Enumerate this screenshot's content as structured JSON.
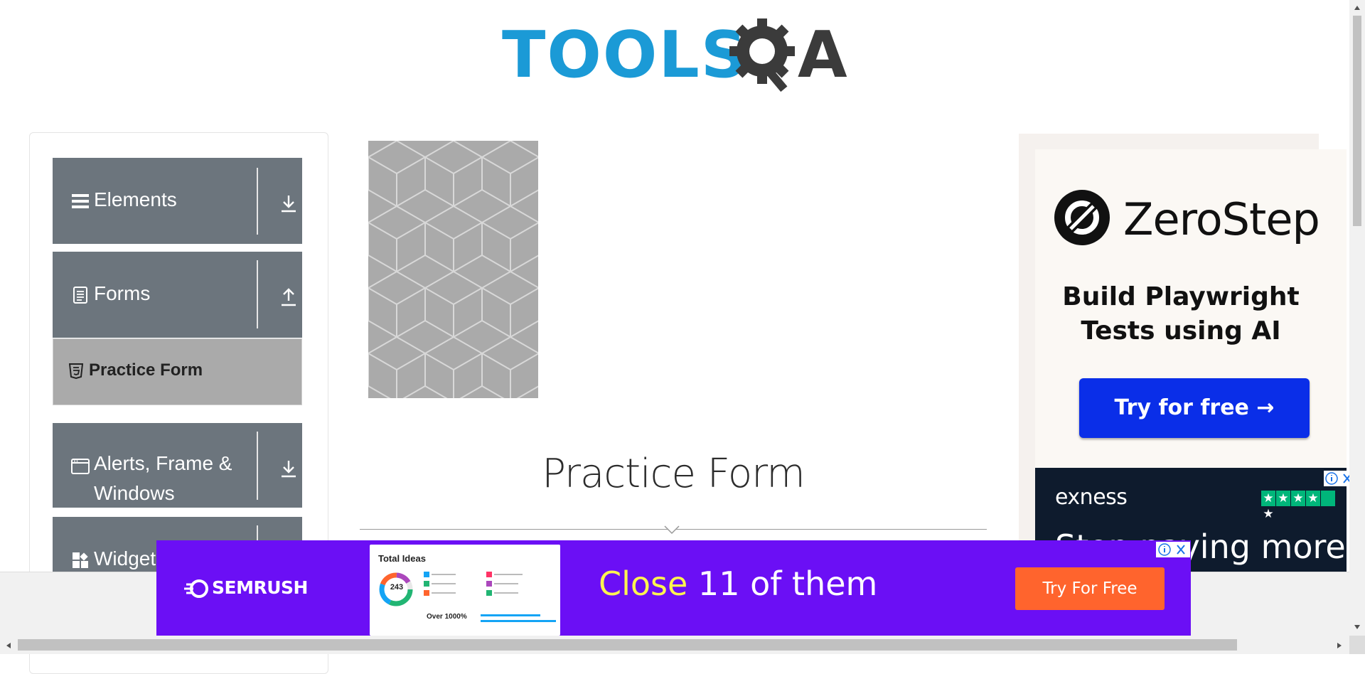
{
  "header": {
    "logo_text_part1": "TOOLS",
    "logo_text_part2": "A"
  },
  "sidebar": {
    "groups": [
      {
        "label": "Elements",
        "icon": "hamburger-icon",
        "toggle": "download-arrow-icon"
      },
      {
        "label": "Forms",
        "icon": "document-icon",
        "toggle": "upload-arrow-icon"
      },
      {
        "label": "Alerts, Frame &\nWindows",
        "icon": "window-icon",
        "toggle": "download-arrow-icon"
      },
      {
        "label": "Widgets",
        "icon": "widgets-icon",
        "toggle": "download-arrow-icon"
      }
    ],
    "active_item": {
      "label": "Practice Form",
      "icon": "html5-icon"
    }
  },
  "main": {
    "title": "Practice Form"
  },
  "right_ad": {
    "brand": "ZeroStep",
    "tagline": "Build Playwright Tests using AI",
    "cta": "Try for free →"
  },
  "exness_ad": {
    "brand": "exness",
    "text": "Stop paying more"
  },
  "bottom_ad": {
    "brand": "SEMRUSH",
    "card_title": "Total Ideas",
    "card_total": "243",
    "card_over": "Over 1000%",
    "headline_highlight": "Close",
    "headline_rest": " 11 of them",
    "cta": "Try For Free"
  },
  "colors": {
    "brand_blue": "#1b9ad6",
    "nav_gray": "#6c757d",
    "active_item_gray": "#aaaaaa",
    "zerostep_button": "#0a2ee8",
    "semrush_purple": "#6b0ff5",
    "semrush_orange": "#ff642d"
  }
}
